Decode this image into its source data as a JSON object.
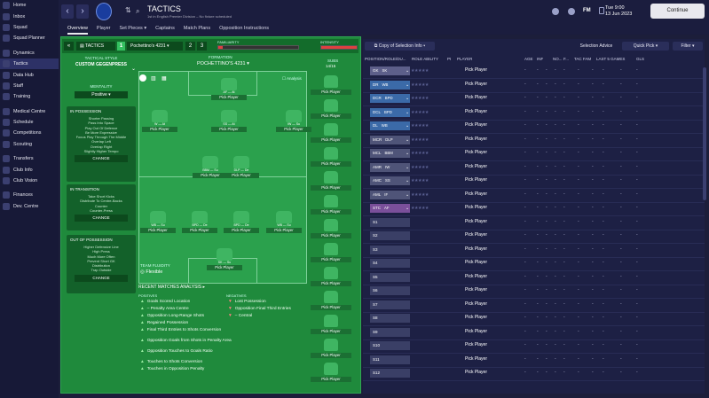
{
  "sidebar": {
    "items": [
      "Home",
      "Inbox",
      "Squad",
      "Squad Planner",
      "Dynamics",
      "Tactics",
      "Data Hub",
      "Staff",
      "Training",
      "Medical Centre",
      "Schedule",
      "Competitions",
      "Scouting",
      "Transfers",
      "Club Info",
      "Club Vision",
      "Finances",
      "Dev. Centre"
    ]
  },
  "topbar": {
    "title": "TACTICS",
    "subtitle": "1st in English Premier Division – No fixture scheduled",
    "date_day": "Tue 9:00",
    "date": "13 Jun 2023",
    "continue": "Continue",
    "icons": [
      "chevron-left-icon",
      "chevron-right-icon",
      "club-badge-icon",
      "search-icon",
      "help-icon",
      "settings-icon",
      "fm-logo-icon"
    ]
  },
  "tabs": [
    "Overview",
    "Player",
    "Set Pieces ▾",
    "Captains",
    "Match Plans",
    "Opposition Instructions"
  ],
  "tactics_bar": {
    "label": "TACTICS",
    "slot1": "1",
    "formation": "Pochettino's 4231",
    "slot2": "2",
    "slot3": "3",
    "familiarity": "FAMILIARITY",
    "intensity": "INTENSITY"
  },
  "style": {
    "heading": "TACTICAL STYLE",
    "name": "CUSTOM GEGENPRESS",
    "mentality_label": "MENTALITY",
    "mentality": "Positive"
  },
  "panels": [
    {
      "title": "IN POSSESSION",
      "items": [
        "Shorter Passing",
        "Pass Into Space",
        "Play Out Of Defence",
        "Be More Expressive",
        "Focus Play Through The Middle",
        "Overlap Left",
        "Overlap Right",
        "Slightly Higher Tempo"
      ],
      "button": "CHANGE"
    },
    {
      "title": "IN TRANSITION",
      "items": [
        "Take Short Kicks",
        "Distribute To Centre-Backs",
        "Counter",
        "Counter-Press"
      ],
      "button": "CHANGE"
    },
    {
      "title": "OUT OF POSSESSION",
      "items": [
        "Higher Defensive Line",
        "High Press",
        "Much More Often",
        "Prevent Short GK",
        "Distribution",
        "Trap Outside"
      ],
      "button": "CHANGE"
    }
  ],
  "pitch": {
    "formation_label": "FORMATION",
    "formation_name": "POCHETTINO'S 4231",
    "analysis": "Analysis",
    "subs_label": "SUBS",
    "subs_count": "14/15",
    "fluidity_label": "TEAM FLUIDITY",
    "fluidity": "Flexible",
    "pick": "Pick Player",
    "players": [
      {
        "role": "AF — At"
      },
      {
        "role": "W — At"
      },
      {
        "role": "SS — At"
      },
      {
        "role": "IW — Su"
      },
      {
        "role": "BBM — Su"
      },
      {
        "role": "DLP — De"
      },
      {
        "role": "WB — Su"
      },
      {
        "role": "BPD — De"
      },
      {
        "role": "BPD — De"
      },
      {
        "role": "WB — Su"
      },
      {
        "role": "SK — Su"
      }
    ]
  },
  "analysis": {
    "heading": "RECENT MATCHES ANALYSIS ▸",
    "positives_label": "POSITIVES",
    "negatives_label": "NEGATIVES",
    "positives": [
      "Goals Scored Location",
      "– Penalty Area Centre",
      "Opposition Long-Range Shots",
      "Regained Possession",
      "Final Third Entries to Shots Conversion",
      "Opposition Goals from Shots in Penalty Area",
      "Opposition Touches to Goals Ratio",
      "Touches to Shots Conversion",
      "Touches in Opposition Penalty"
    ],
    "negatives": [
      "Lost Possession",
      "Opposition Final Third Entries",
      "– Central"
    ]
  },
  "right_panel": {
    "copy_btn": "Copy of Selection Info",
    "advice_btn": "Selection Advice",
    "quick_pick": "Quick Pick",
    "filter": "Filter",
    "headers": [
      "POSITION/ROLE/DU...",
      "ROLE ABILITY",
      "PI",
      "PLAYER",
      "AGE",
      "INF",
      "NO...",
      "F...",
      "TAC FAM",
      "LAST 5 GAMES",
      "GLS"
    ],
    "rows": [
      {
        "pos": "GK",
        "role": "SK",
        "duty": "Defend"
      },
      {
        "pos": "DR",
        "role": "WB",
        "duty": "Support"
      },
      {
        "pos": "DCR",
        "role": "BPD",
        "duty": "Defend"
      },
      {
        "pos": "DCL",
        "role": "BPD",
        "duty": "Defend"
      },
      {
        "pos": "DL",
        "role": "WB",
        "duty": "Support"
      },
      {
        "pos": "MCR",
        "role": "DLP",
        "duty": "Defend"
      },
      {
        "pos": "MCL",
        "role": "BBM",
        "duty": "Support"
      },
      {
        "pos": "AMR",
        "role": "IW",
        "duty": "Support"
      },
      {
        "pos": "AMC",
        "role": "SS",
        "duty": "Attack"
      },
      {
        "pos": "AML",
        "role": "IF",
        "duty": "Attack"
      },
      {
        "pos": "STC",
        "role": "AF",
        "duty": "Attack"
      },
      {
        "pos": "S1"
      },
      {
        "pos": "S2"
      },
      {
        "pos": "S3"
      },
      {
        "pos": "S4"
      },
      {
        "pos": "S5"
      },
      {
        "pos": "S6"
      },
      {
        "pos": "S7"
      },
      {
        "pos": "S8"
      },
      {
        "pos": "S9"
      },
      {
        "pos": "S10"
      },
      {
        "pos": "S11"
      },
      {
        "pos": "S12"
      }
    ],
    "pick": "Pick Player",
    "dash": "-"
  }
}
